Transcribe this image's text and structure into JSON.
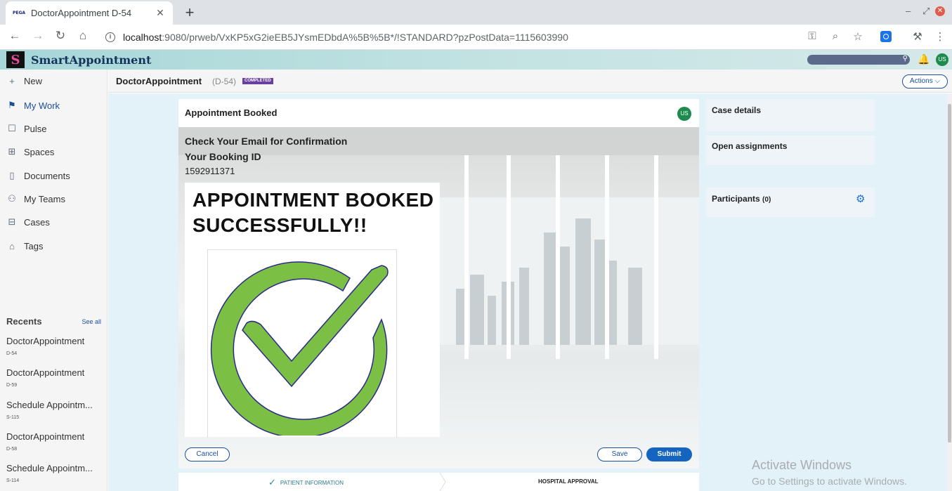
{
  "browser": {
    "tab_favicon": "PEGA",
    "tab_title": "DoctorAppointment D-54",
    "url_host": "localhost",
    "url_path": ":9080/prweb/VxKP5xG2ieEB5JYsmEDbdA%5B%5B*/!STANDARD?pzPostData=1115603990"
  },
  "app": {
    "logo_letter": "S",
    "title": "SmartAppointment",
    "user_initials": "US"
  },
  "nav": {
    "items": [
      {
        "label": "New",
        "icon": "plus-icon"
      },
      {
        "label": "My Work",
        "icon": "flag-icon"
      },
      {
        "label": "Pulse",
        "icon": "chat-icon"
      },
      {
        "label": "Spaces",
        "icon": "grid-icon"
      },
      {
        "label": "Documents",
        "icon": "document-icon"
      },
      {
        "label": "My Teams",
        "icon": "team-icon"
      },
      {
        "label": "Cases",
        "icon": "briefcase-icon"
      },
      {
        "label": "Tags",
        "icon": "tag-icon"
      }
    ],
    "recents_title": "Recents",
    "see_all": "See all",
    "recents": [
      {
        "title": "DoctorAppointment",
        "id": "D-54"
      },
      {
        "title": "DoctorAppointment",
        "id": "D-59"
      },
      {
        "title": "Schedule Appointm...",
        "id": "S-115"
      },
      {
        "title": "DoctorAppointment",
        "id": "D-58"
      },
      {
        "title": "Schedule Appointm...",
        "id": "S-114"
      }
    ]
  },
  "case": {
    "title": "DoctorAppointment",
    "id": "(D-54)",
    "status": "COMPLETED",
    "actions_label": "Actions"
  },
  "card": {
    "title": "Appointment Booked",
    "user_initials": "US",
    "line1": "Check Your Email for Confirmation",
    "line2": "Your Booking ID",
    "booking_id": "1592911371",
    "success_line1": "APPOINTMENT BOOKED",
    "success_line2": "SUCCESSFULLY!!",
    "cancel_label": "Cancel",
    "save_label": "Save",
    "submit_label": "Submit"
  },
  "stages": {
    "stage1": "PATIENT INFORMATION",
    "stage2": "HOSPITAL APPROVAL"
  },
  "side": {
    "case_details": "Case details",
    "open_assignments": "Open assignments",
    "participants": "Participants",
    "participants_count": "(0)"
  },
  "watermark": {
    "line1": "Activate Windows",
    "line2": "Go to Settings to activate Windows."
  },
  "colors": {
    "brand": "#13335a",
    "accent": "#1565c0",
    "check_green": "#7bbf45",
    "status_badge": "#6b3fa0"
  }
}
